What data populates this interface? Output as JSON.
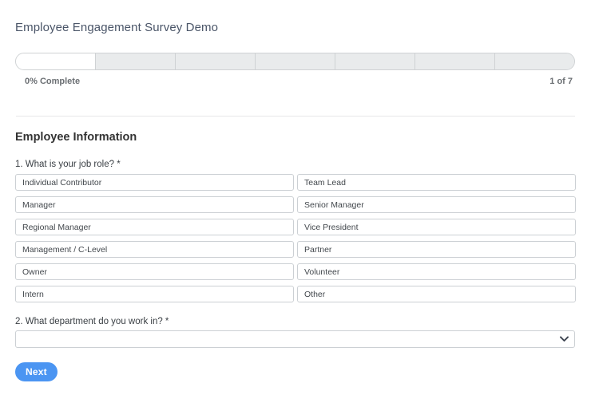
{
  "survey": {
    "title": "Employee Engagement Survey Demo"
  },
  "progress": {
    "total_steps": 7,
    "current_step": 1,
    "percent_label": "0% Complete",
    "step_label": "1 of 7",
    "filled_segments": 1,
    "fill_color": "#ffffff",
    "track_color": "#e9ebec",
    "border_color": "#cfd2d4"
  },
  "section": {
    "heading": "Employee Information"
  },
  "questions": [
    {
      "number": 1,
      "label": "1. What is your job role? *",
      "type": "choice-grid",
      "options": [
        "Individual Contributor",
        "Team Lead",
        "Manager",
        "Senior Manager",
        "Regional Manager",
        "Vice President",
        "Management / C-Level",
        "Partner",
        "Owner",
        "Volunteer",
        "Intern",
        "Other"
      ]
    },
    {
      "number": 2,
      "label": "2. What department do you work in? *",
      "type": "select",
      "selected_value": "",
      "placeholder": "",
      "chevron_icon": "chevron-down-icon"
    }
  ],
  "footer": {
    "next_label": "Next",
    "next_color": "#4b95f2"
  }
}
